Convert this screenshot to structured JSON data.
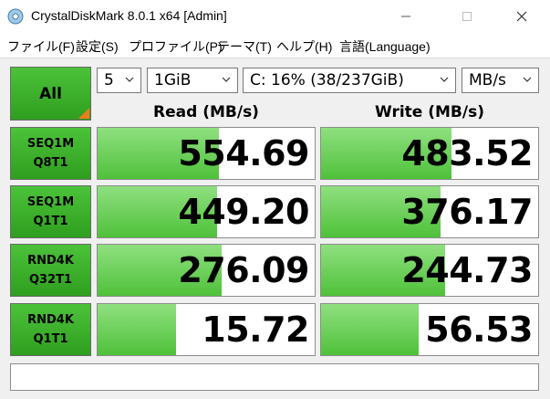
{
  "window": {
    "title": "CrystalDiskMark 8.0.1 x64 [Admin]",
    "minimize_icon": "minimize-icon",
    "maximize_icon": "maximize-icon",
    "close_icon": "close-icon"
  },
  "menu": [
    "ファイル(F)",
    "設定(S)",
    "プロファイル(P)",
    "テーマ(T)",
    "ヘルプ(H)",
    "言語(Language)"
  ],
  "toolbar": {
    "all_label": "All",
    "count": "5",
    "size": "1GiB",
    "drive": "C: 16% (38/237GiB)",
    "unit": "MB/s"
  },
  "headers": {
    "read": "Read (MB/s)",
    "write": "Write (MB/s)"
  },
  "colors": {
    "accent_green": "#3fb02c",
    "bar_green": "#6fd35a",
    "corner_orange": "#f07c1e"
  },
  "tests": [
    {
      "line1": "SEQ1M",
      "line2": "Q8T1",
      "read": "554.69",
      "write": "483.52",
      "read_fill": 0.56,
      "write_fill": 0.6
    },
    {
      "line1": "SEQ1M",
      "line2": "Q1T1",
      "read": "449.20",
      "write": "376.17",
      "read_fill": 0.55,
      "write_fill": 0.55
    },
    {
      "line1": "RND4K",
      "line2": "Q32T1",
      "read": "276.09",
      "write": "244.73",
      "read_fill": 0.57,
      "write_fill": 0.57
    },
    {
      "line1": "RND4K",
      "line2": "Q1T1",
      "read": "15.72",
      "write": "56.53",
      "read_fill": 0.36,
      "write_fill": 0.45
    }
  ],
  "status": ""
}
